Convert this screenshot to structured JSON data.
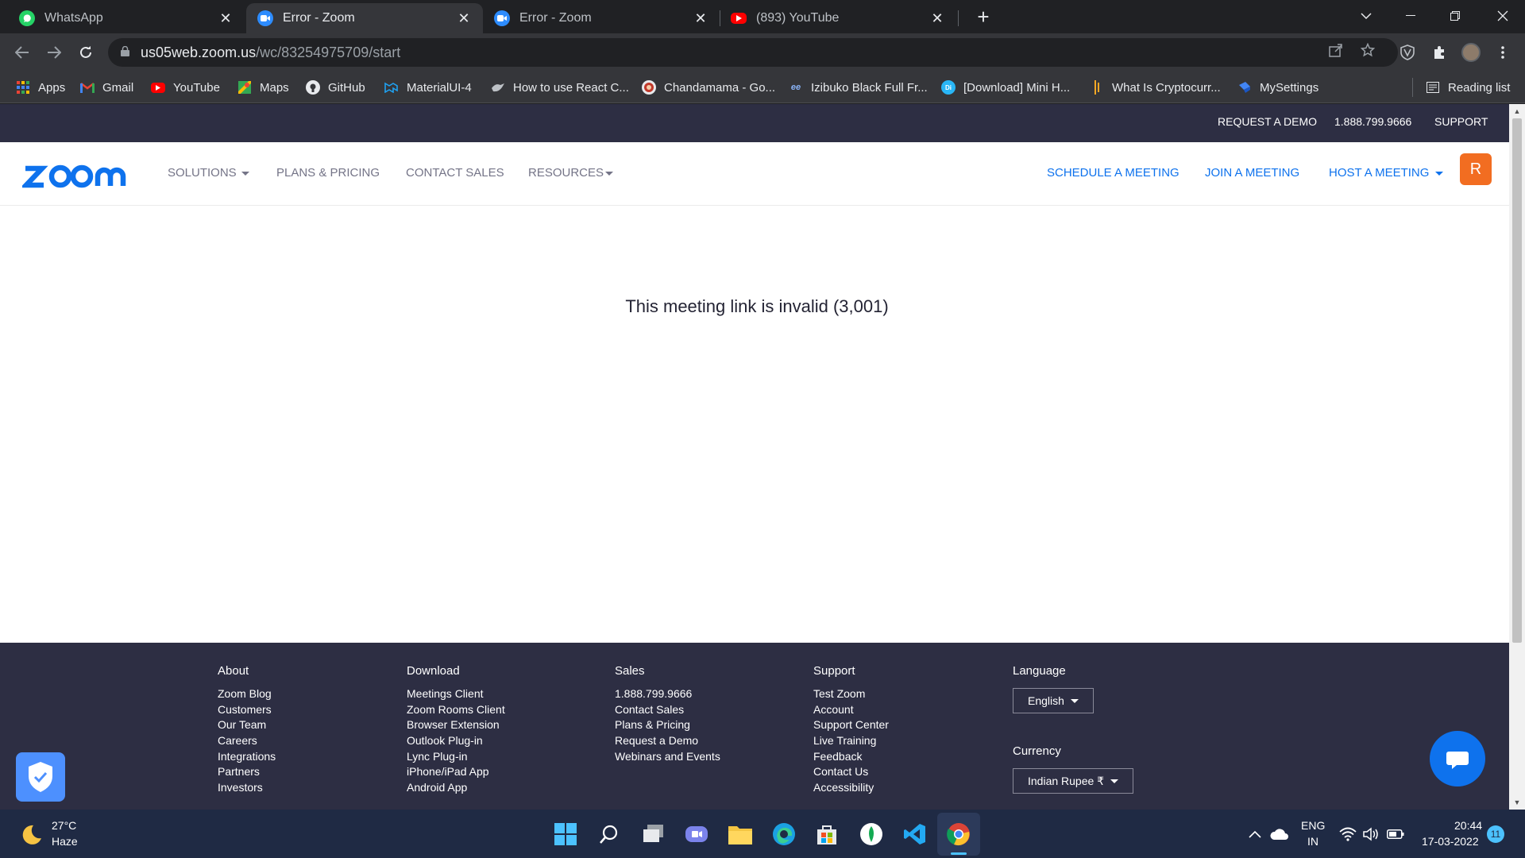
{
  "browser": {
    "tabs": [
      {
        "title": "WhatsApp",
        "icon": "whatsapp-icon",
        "active": false
      },
      {
        "title": "Error - Zoom",
        "icon": "zoom-icon",
        "active": true
      },
      {
        "title": "Error - Zoom",
        "icon": "zoom-icon",
        "active": false
      },
      {
        "title": "(893) YouTube",
        "icon": "youtube-icon",
        "active": false
      }
    ],
    "url_host": "us05web.zoom.us",
    "url_path": "/wc/83254975709/start",
    "bookmarks": [
      {
        "label": "Apps",
        "icon": "apps-grid-icon"
      },
      {
        "label": "Gmail",
        "icon": "gmail-icon"
      },
      {
        "label": "YouTube",
        "icon": "youtube-icon"
      },
      {
        "label": "Maps",
        "icon": "maps-icon"
      },
      {
        "label": "GitHub",
        "icon": "github-icon"
      },
      {
        "label": "MaterialUI-4",
        "icon": "materialui-icon"
      },
      {
        "label": "How to use React C...",
        "icon": "bird-icon"
      },
      {
        "label": "Chandamama - Go...",
        "icon": "chandamama-icon"
      },
      {
        "label": "Izibuko Black Full Fr...",
        "icon": "ee-icon"
      },
      {
        "label": "[Download] Mini H...",
        "icon": "download-site-icon"
      },
      {
        "label": "What Is Cryptocurr...",
        "icon": "crypto-icon"
      },
      {
        "label": "MySettings",
        "icon": "mysettings-icon"
      }
    ],
    "reading_list": "Reading list"
  },
  "zoom": {
    "topbar": {
      "request_demo": "REQUEST A DEMO",
      "phone": "1.888.799.9666",
      "support": "SUPPORT"
    },
    "nav": {
      "solutions": "SOLUTIONS",
      "plans": "PLANS & PRICING",
      "contact_sales": "CONTACT SALES",
      "resources": "RESOURCES",
      "schedule": "SCHEDULE A MEETING",
      "join": "JOIN A MEETING",
      "host": "HOST A MEETING",
      "avatar_initial": "R"
    },
    "error_message": "This meeting link is invalid (3,001)",
    "footer": {
      "about": {
        "heading": "About",
        "links": [
          "Zoom Blog",
          "Customers",
          "Our Team",
          "Careers",
          "Integrations",
          "Partners",
          "Investors"
        ]
      },
      "download": {
        "heading": "Download",
        "links": [
          "Meetings Client",
          "Zoom Rooms Client",
          "Browser Extension",
          "Outlook Plug-in",
          "Lync Plug-in",
          "iPhone/iPad App",
          "Android App"
        ]
      },
      "sales": {
        "heading": "Sales",
        "links": [
          "1.888.799.9666",
          "Contact Sales",
          "Plans & Pricing",
          "Request a Demo",
          "Webinars and Events"
        ]
      },
      "support": {
        "heading": "Support",
        "links": [
          "Test Zoom",
          "Account",
          "Support Center",
          "Live Training",
          "Feedback",
          "Contact Us",
          "Accessibility"
        ]
      },
      "language": {
        "heading": "Language",
        "value": "English"
      },
      "currency": {
        "heading": "Currency",
        "value": "Indian Rupee ₹"
      }
    }
  },
  "taskbar": {
    "weather_temp": "27°C",
    "weather_desc": "Haze",
    "lang": "ENG",
    "region": "IN",
    "time": "20:44",
    "date": "17-03-2022",
    "notif_count": "11"
  },
  "colors": {
    "zoom_blue": "#0e72ed",
    "zoom_dark": "#2d2e43",
    "avatar_orange": "#f26d21"
  }
}
